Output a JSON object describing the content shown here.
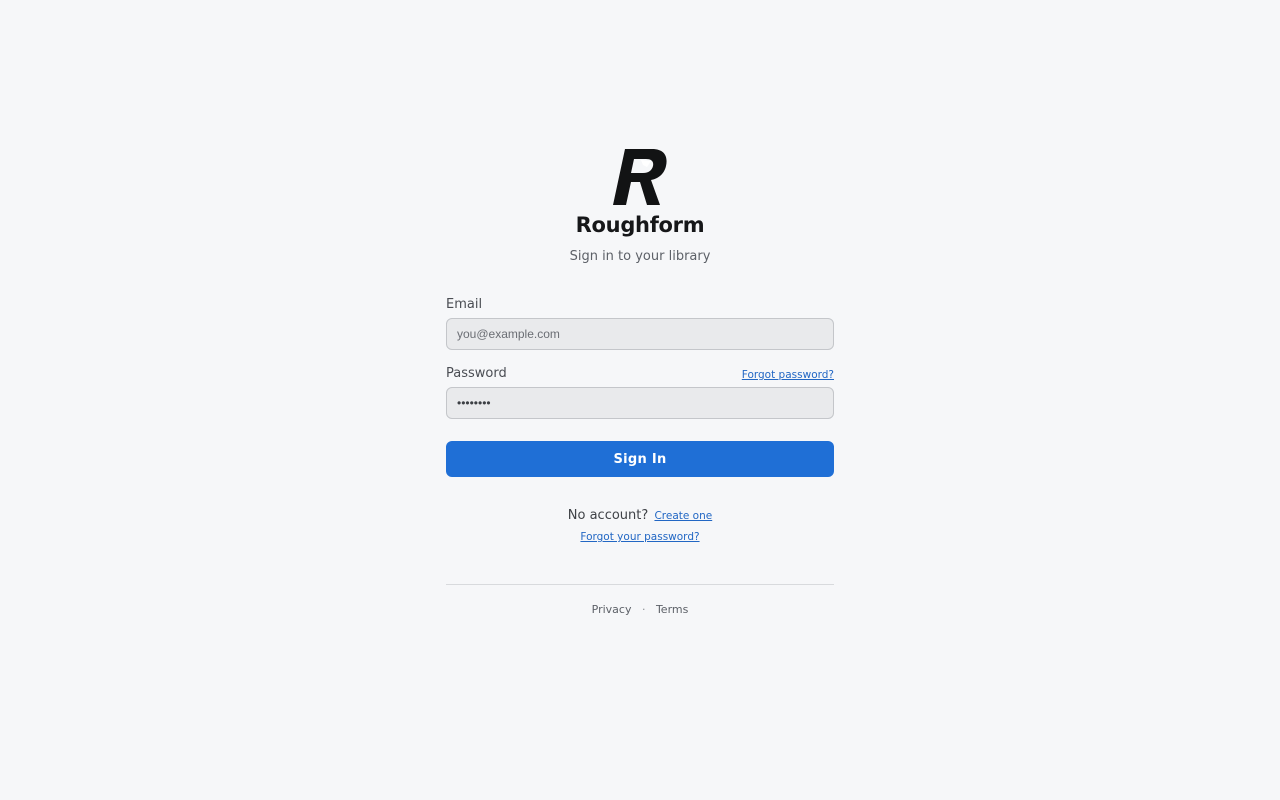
{
  "brand": {
    "logo_letter": "R",
    "name": "Roughform",
    "tagline": "Sign in to your library"
  },
  "form": {
    "email": {
      "label": "Email",
      "placeholder": "you@example.com",
      "value": ""
    },
    "password": {
      "label": "Password",
      "value": "••••••••",
      "forgot_link": "Forgot password?"
    },
    "submit_label": "Sign In"
  },
  "alt": {
    "no_account_text": "No account?",
    "create_link": "Create one",
    "forgot_link": "Forgot your password?"
  },
  "footer": {
    "privacy": "Privacy",
    "separator": "·",
    "terms": "Terms"
  },
  "colors": {
    "background": "#f6f7f9",
    "primary": "#1f6fd6",
    "link": "#2267c4",
    "input_bg": "#e9eaec"
  }
}
